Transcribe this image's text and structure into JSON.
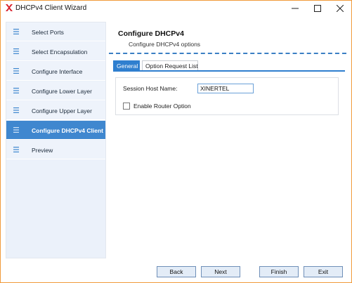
{
  "window": {
    "title": "DHCPv4 Client Wizard",
    "controls": {
      "minimize": "—",
      "maximize": "☐",
      "close": "✕"
    },
    "icon": "red-x-logo-icon"
  },
  "sidebar": {
    "items": [
      {
        "label": "Select Ports",
        "icon": "list-icon",
        "active": false
      },
      {
        "label": "Select Encapsulation",
        "icon": "list-icon",
        "active": false
      },
      {
        "label": "Configure Interface",
        "icon": "list-icon",
        "active": false
      },
      {
        "label": "Configure Lower Layer",
        "icon": "list-icon",
        "active": false
      },
      {
        "label": "Configure Upper Layer",
        "icon": "list-icon",
        "active": false
      },
      {
        "label": "Configure DHCPv4 Client",
        "icon": "list-icon",
        "active": true
      },
      {
        "label": "Preview",
        "icon": "list-icon",
        "active": false
      }
    ]
  },
  "main": {
    "title": "Configure DHCPv4",
    "subtitle": "Configure DHCPv4 options",
    "tabs": [
      {
        "label": "General",
        "active": true
      },
      {
        "label": "Option Request List",
        "active": false
      }
    ],
    "general": {
      "session_host_label": "Session Host Name:",
      "session_host_value": "XINERTEL",
      "router_option_label": "Enable Router Option",
      "router_option_checked": false
    }
  },
  "footer": {
    "back": "Back",
    "next": "Next",
    "finish": "Finish",
    "exit": "Exit"
  },
  "colors": {
    "accent": "#3f87cf",
    "sidebar_bg": "#ebf1fa",
    "button_bg": "#e3ecf7",
    "window_border": "#f09a3a",
    "logo_red": "#d8202a"
  }
}
